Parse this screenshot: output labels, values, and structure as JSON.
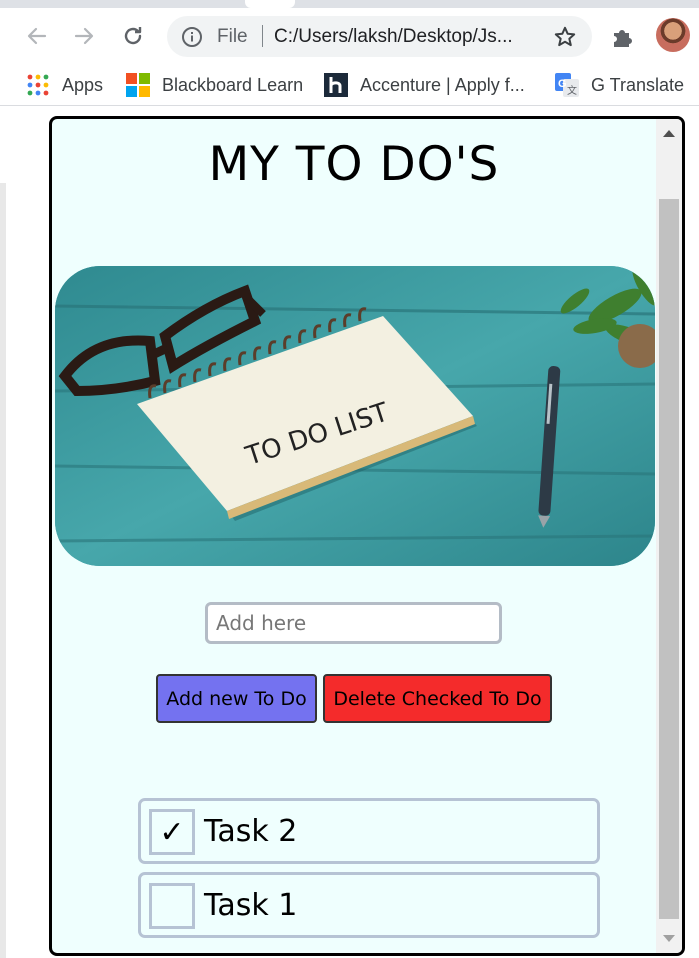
{
  "browser": {
    "omnibox": {
      "scheme_label": "File",
      "url": "C:/Users/laksh/Desktop/Js..."
    },
    "bookmarks": [
      {
        "label": "Apps",
        "icon": "apps-grid-icon"
      },
      {
        "label": "Blackboard Learn",
        "icon": "microsoft-logo-icon"
      },
      {
        "label": "Accenture | Apply f...",
        "icon": "h-logo-icon"
      },
      {
        "label": "G Translate",
        "icon": "google-translate-icon"
      }
    ]
  },
  "page": {
    "title": "MY TO DO'S",
    "hero_image": {
      "notepad_text": "TO DO LIST"
    },
    "input": {
      "placeholder": "Add here",
      "value": ""
    },
    "buttons": {
      "add_label": "Add new To Do",
      "delete_label": "Delete Checked To Do"
    },
    "todos": [
      {
        "label": "Task 2",
        "checked": true,
        "check_mark": "✓"
      },
      {
        "label": "Task 1",
        "checked": false,
        "check_mark": ""
      }
    ]
  },
  "colors": {
    "page_background": "#effffe",
    "add_button": "#7472f0",
    "delete_button": "#f42b2b",
    "item_border": "#b6c3d4"
  }
}
